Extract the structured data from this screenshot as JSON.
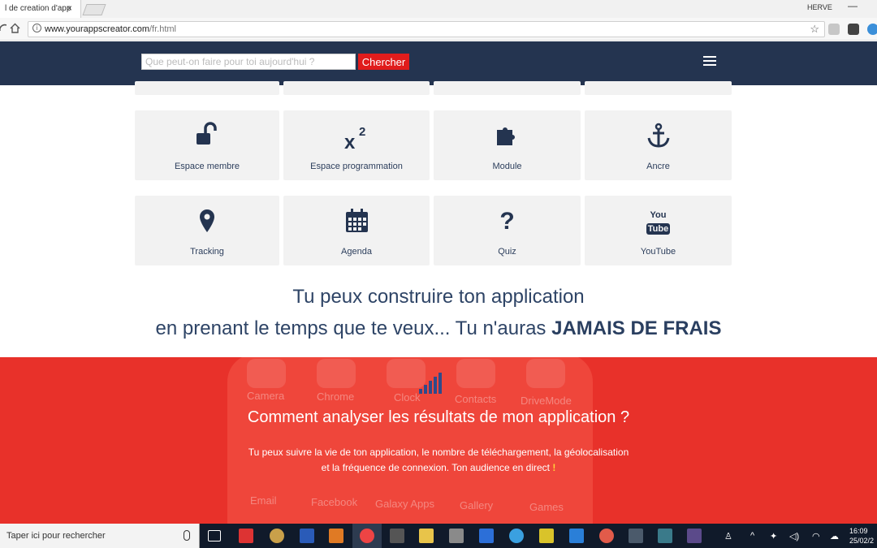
{
  "browser": {
    "tab_title": "l de creation d'app",
    "tab_close": "×",
    "profile": "HERVE",
    "minimize": "—",
    "url_host": "www.yourappscreator.com",
    "url_path": "/fr.html",
    "info": "i",
    "star": "☆"
  },
  "header": {
    "search_placeholder": "Que peut-on faire pour toi aujourd'hui ?",
    "search_button": "Chercher"
  },
  "features": [
    {
      "label": "Espace membre",
      "icon": "unlock-icon"
    },
    {
      "label": "Espace programmation",
      "icon": "superscript-icon"
    },
    {
      "label": "Module",
      "icon": "puzzle-icon"
    },
    {
      "label": "Ancre",
      "icon": "anchor-icon"
    },
    {
      "label": "Tracking",
      "icon": "map-marker-icon"
    },
    {
      "label": "Agenda",
      "icon": "calendar-icon"
    },
    {
      "label": "Quiz",
      "icon": "question-icon"
    },
    {
      "label": "YouTube",
      "icon": "youtube-icon"
    }
  ],
  "icon_glyphs": {
    "superscript": "x",
    "superscript_exp": "2",
    "question": "?",
    "youtube_top": "You",
    "youtube_bottom": "Tube"
  },
  "headline": {
    "line1": "Tu peux construire ton application",
    "line2_prefix": "en prenant le temps que te veux... Tu n'auras ",
    "line2_bold": "JAMAIS DE FRAIS"
  },
  "analytics": {
    "title": "Comment analyser les résultats de mon application ?",
    "line1": "Tu peux suivre la vie de ton application, le nombre de téléchargement, la géolocalisation",
    "line2": "et la fréquence de connexion. Ton audience en direct ",
    "line2_mark": "!",
    "bg_apps": [
      "Camera",
      "Chrome",
      "Clock",
      "Contacts",
      "DriveMode",
      "Email",
      "Facebook",
      "Galaxy Apps",
      "Gallery",
      "Games"
    ]
  },
  "taskbar": {
    "search_text": "Taper ici pour rechercher",
    "time": "16:09",
    "date": "25/02/2"
  },
  "colors": {
    "header_bg": "#243450",
    "accent_red": "#e01c1c",
    "section_red": "#e8312a",
    "text_navy": "#2e4466",
    "card_bg": "#f2f2f2"
  }
}
